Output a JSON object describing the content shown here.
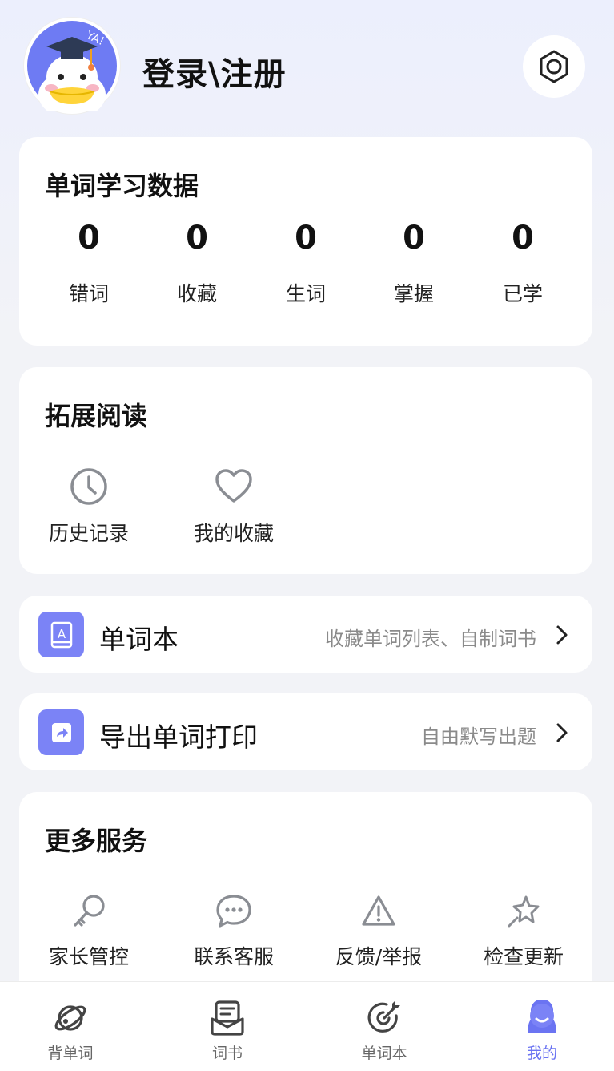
{
  "header": {
    "login_text": "登录\\注册"
  },
  "stats": {
    "title": "单词学习数据",
    "items": [
      {
        "value": "0",
        "label": "错词"
      },
      {
        "value": "0",
        "label": "收藏"
      },
      {
        "value": "0",
        "label": "生词"
      },
      {
        "value": "0",
        "label": "掌握"
      },
      {
        "value": "0",
        "label": "已学"
      }
    ]
  },
  "reading": {
    "title": "拓展阅读",
    "items": [
      {
        "label": "历史记录",
        "icon": "clock-icon"
      },
      {
        "label": "我的收藏",
        "icon": "heart-icon"
      }
    ]
  },
  "wordbook_row": {
    "title": "单词本",
    "subtitle": "收藏单词列表、自制词书",
    "icon": "book-icon"
  },
  "export_row": {
    "title": "导出单词打印",
    "subtitle": "自由默写出题",
    "icon": "share-icon"
  },
  "services": {
    "title": "更多服务",
    "items": [
      {
        "label": "家长管控",
        "icon": "key-icon"
      },
      {
        "label": "联系客服",
        "icon": "chat-icon"
      },
      {
        "label": "反馈/举报",
        "icon": "warning-icon"
      },
      {
        "label": "检查更新",
        "icon": "star-icon"
      }
    ]
  },
  "tabbar": {
    "items": [
      {
        "label": "背单词",
        "icon": "planet-icon"
      },
      {
        "label": "词书",
        "icon": "book-list-icon"
      },
      {
        "label": "单词本",
        "icon": "target-icon"
      },
      {
        "label": "我的",
        "icon": "profile-icon"
      }
    ],
    "active_index": 3
  },
  "colors": {
    "accent": "#6b74f2",
    "icon_bg": "#7b83f6",
    "avatar_bg": "#6e7bf3"
  }
}
